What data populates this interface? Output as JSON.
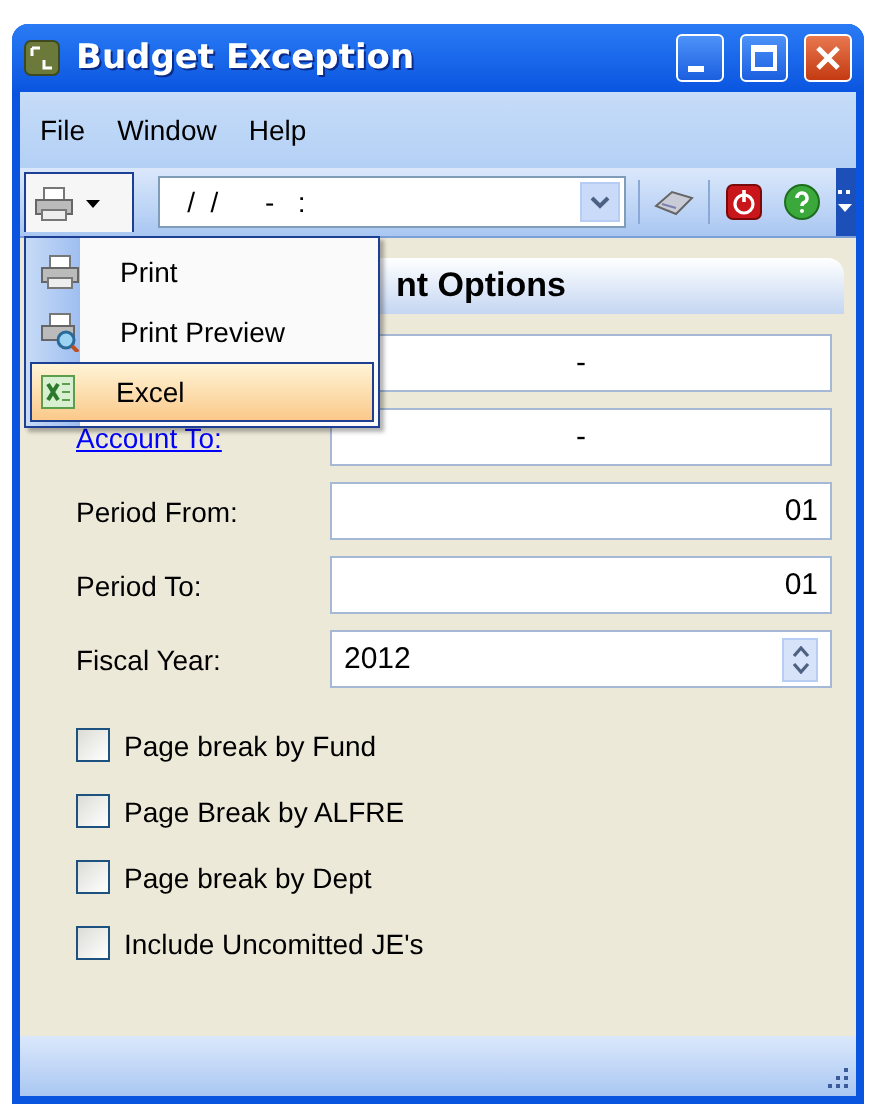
{
  "window": {
    "title": "Budget Exception"
  },
  "menu_bar": [
    {
      "label": "File"
    },
    {
      "label": "Window"
    },
    {
      "label": "Help"
    }
  ],
  "toolbar": {
    "date_field": {
      "value": "/  /      -   :"
    }
  },
  "print_menu": {
    "open": true,
    "items": [
      {
        "kind": "print",
        "label": "Print",
        "selected": false
      },
      {
        "kind": "preview",
        "label": "Print Preview",
        "selected": false
      },
      {
        "kind": "excel",
        "label": "Excel",
        "selected": true
      }
    ]
  },
  "panel": {
    "title": "nt Options"
  },
  "fields": [
    {
      "kind": "code",
      "value": "-"
    },
    {
      "kind": "code",
      "label": "Account To:",
      "link": true,
      "value": "-"
    },
    {
      "kind": "number",
      "label": "Period From:",
      "link": false,
      "value": "01"
    },
    {
      "kind": "number",
      "label": "Period To:",
      "link": false,
      "value": "01"
    },
    {
      "kind": "spinner",
      "label": "Fiscal Year:",
      "link": false,
      "value": "2012"
    }
  ],
  "checkboxes": [
    {
      "label": "Page break by Fund",
      "checked": false
    },
    {
      "label": "Page Break by ALFRE",
      "checked": false
    },
    {
      "label": "Page break by Dept",
      "checked": false
    },
    {
      "label": "Include Uncomitted JE's",
      "checked": false
    }
  ]
}
